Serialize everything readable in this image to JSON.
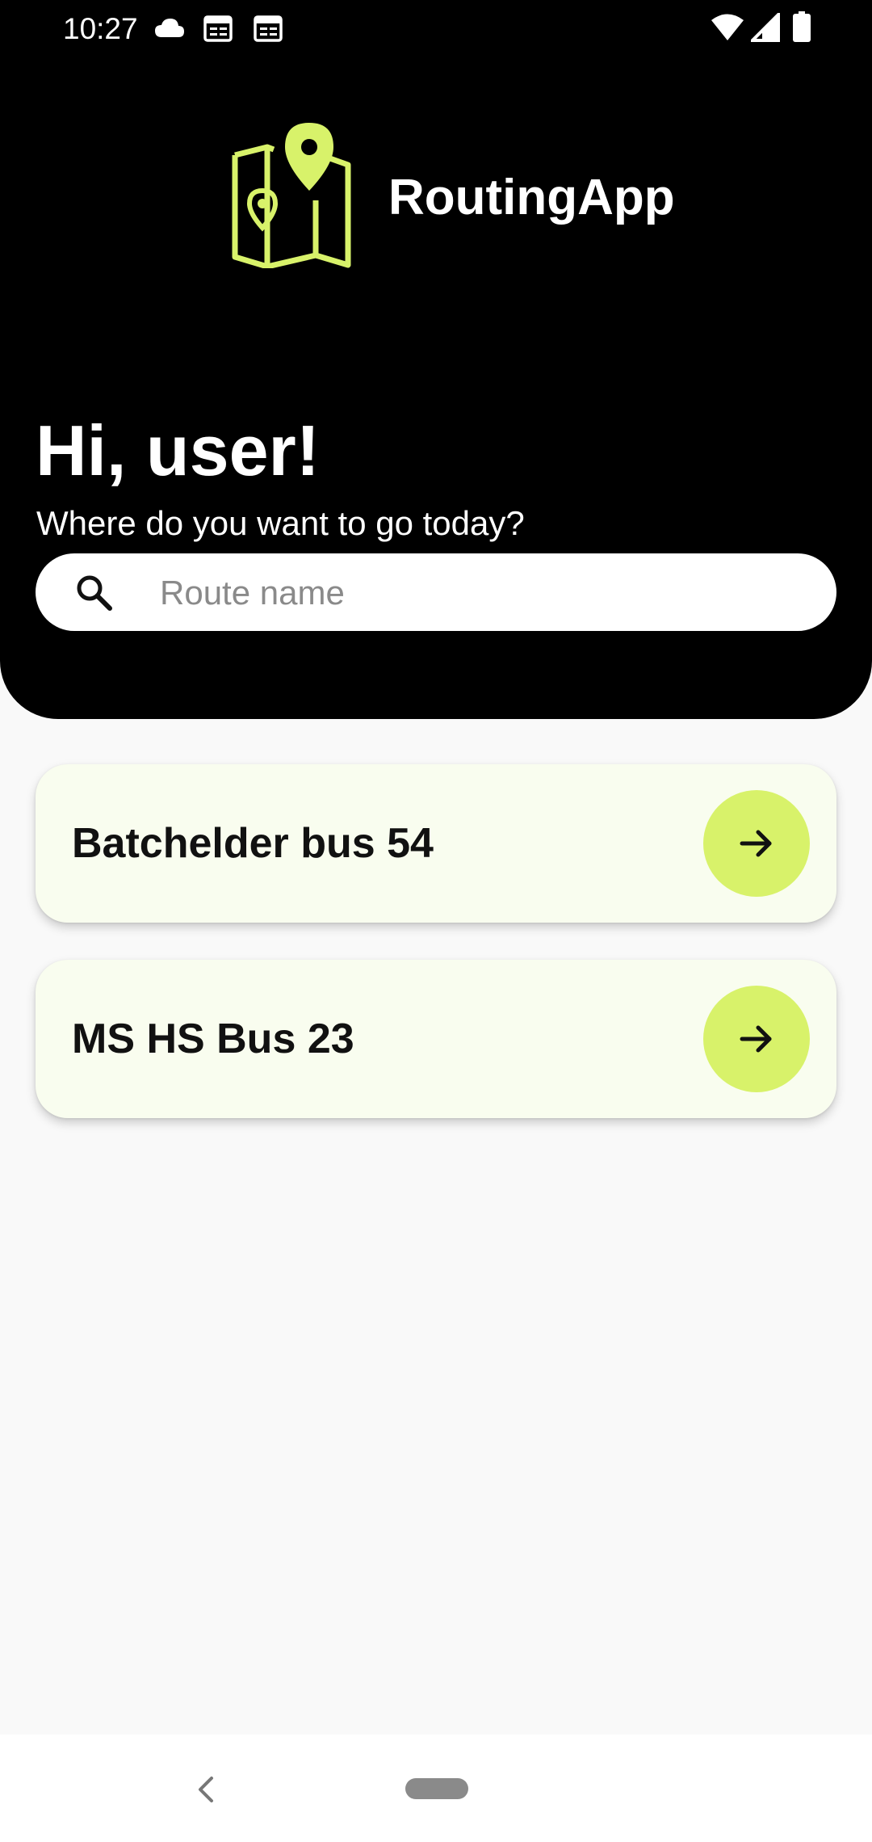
{
  "status_bar": {
    "time": "10:27",
    "left_icons": [
      "cloud-icon",
      "calendar-icon",
      "calendar-icon"
    ],
    "right_icons": [
      "wifi-icon",
      "signal-icon",
      "battery-icon"
    ]
  },
  "header": {
    "app_title": "RoutingApp",
    "logo_icon": "map-pin-icon",
    "greeting": "Hi, user!",
    "subtitle": "Where do you want to go today?"
  },
  "search": {
    "placeholder": "Route name",
    "value": ""
  },
  "routes": [
    {
      "label": "Batchelder bus 54",
      "action_icon": "arrow-right-icon"
    },
    {
      "label": "MS HS Bus 23",
      "action_icon": "arrow-right-icon"
    }
  ],
  "colors": {
    "accent": "#d8f26a",
    "header_bg": "#000000",
    "card_bg": "#f9fdef",
    "page_bg": "#f9f9f9"
  }
}
